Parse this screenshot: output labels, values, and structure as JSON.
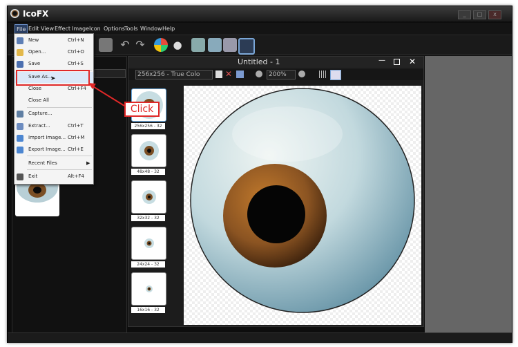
{
  "window": {
    "title": "IcoFX"
  },
  "menubar": {
    "items": [
      "File",
      "Edit",
      "View",
      "Effect",
      "Image",
      "Icon",
      "Options",
      "Tools",
      "Window",
      "Help"
    ]
  },
  "document": {
    "title": "Untitled - 1",
    "format_combo": "256x256 - True Colo",
    "zoom_combo": "200%",
    "thumbnails": [
      "256x256 - 32",
      "48x48 - 32",
      "32x32 - 32",
      "24x24 - 32",
      "16x16 - 32"
    ]
  },
  "file_menu": {
    "items": [
      {
        "label": "New",
        "shortcut": "Ctrl+N",
        "icon": "new-file-icon",
        "color": "#5e7fb5"
      },
      {
        "label": "Open...",
        "shortcut": "Ctrl+O",
        "icon": "open-folder-icon",
        "color": "#e3b84a"
      },
      {
        "label": "Save",
        "shortcut": "Ctrl+S",
        "icon": "save-disk-icon",
        "color": "#4b6fb0"
      },
      {
        "label": "Save As...",
        "shortcut": "",
        "icon": "",
        "color": ""
      },
      {
        "label": "Close",
        "shortcut": "Ctrl+F4",
        "icon": "",
        "color": ""
      },
      {
        "label": "Close All",
        "shortcut": "",
        "icon": "",
        "color": ""
      },
      {
        "label": "Capture...",
        "shortcut": "",
        "icon": "capture-icon",
        "color": "#5f7fa3"
      },
      {
        "label": "Extract...",
        "shortcut": "Ctrl+T",
        "icon": "extract-icon",
        "color": "#6d8cc0"
      },
      {
        "label": "Import Image...",
        "shortcut": "Ctrl+M",
        "icon": "import-image-icon",
        "color": "#4c86d1"
      },
      {
        "label": "Export Image...",
        "shortcut": "Ctrl+E",
        "icon": "export-image-icon",
        "color": "#4c86d1"
      },
      {
        "label": "Recent Files",
        "shortcut": "",
        "icon": "",
        "color": ""
      },
      {
        "label": "Exit",
        "shortcut": "Alt+F4",
        "icon": "exit-icon",
        "color": "#555555"
      }
    ]
  },
  "annotation": {
    "click_label": "Click",
    "color": "#e02828"
  }
}
